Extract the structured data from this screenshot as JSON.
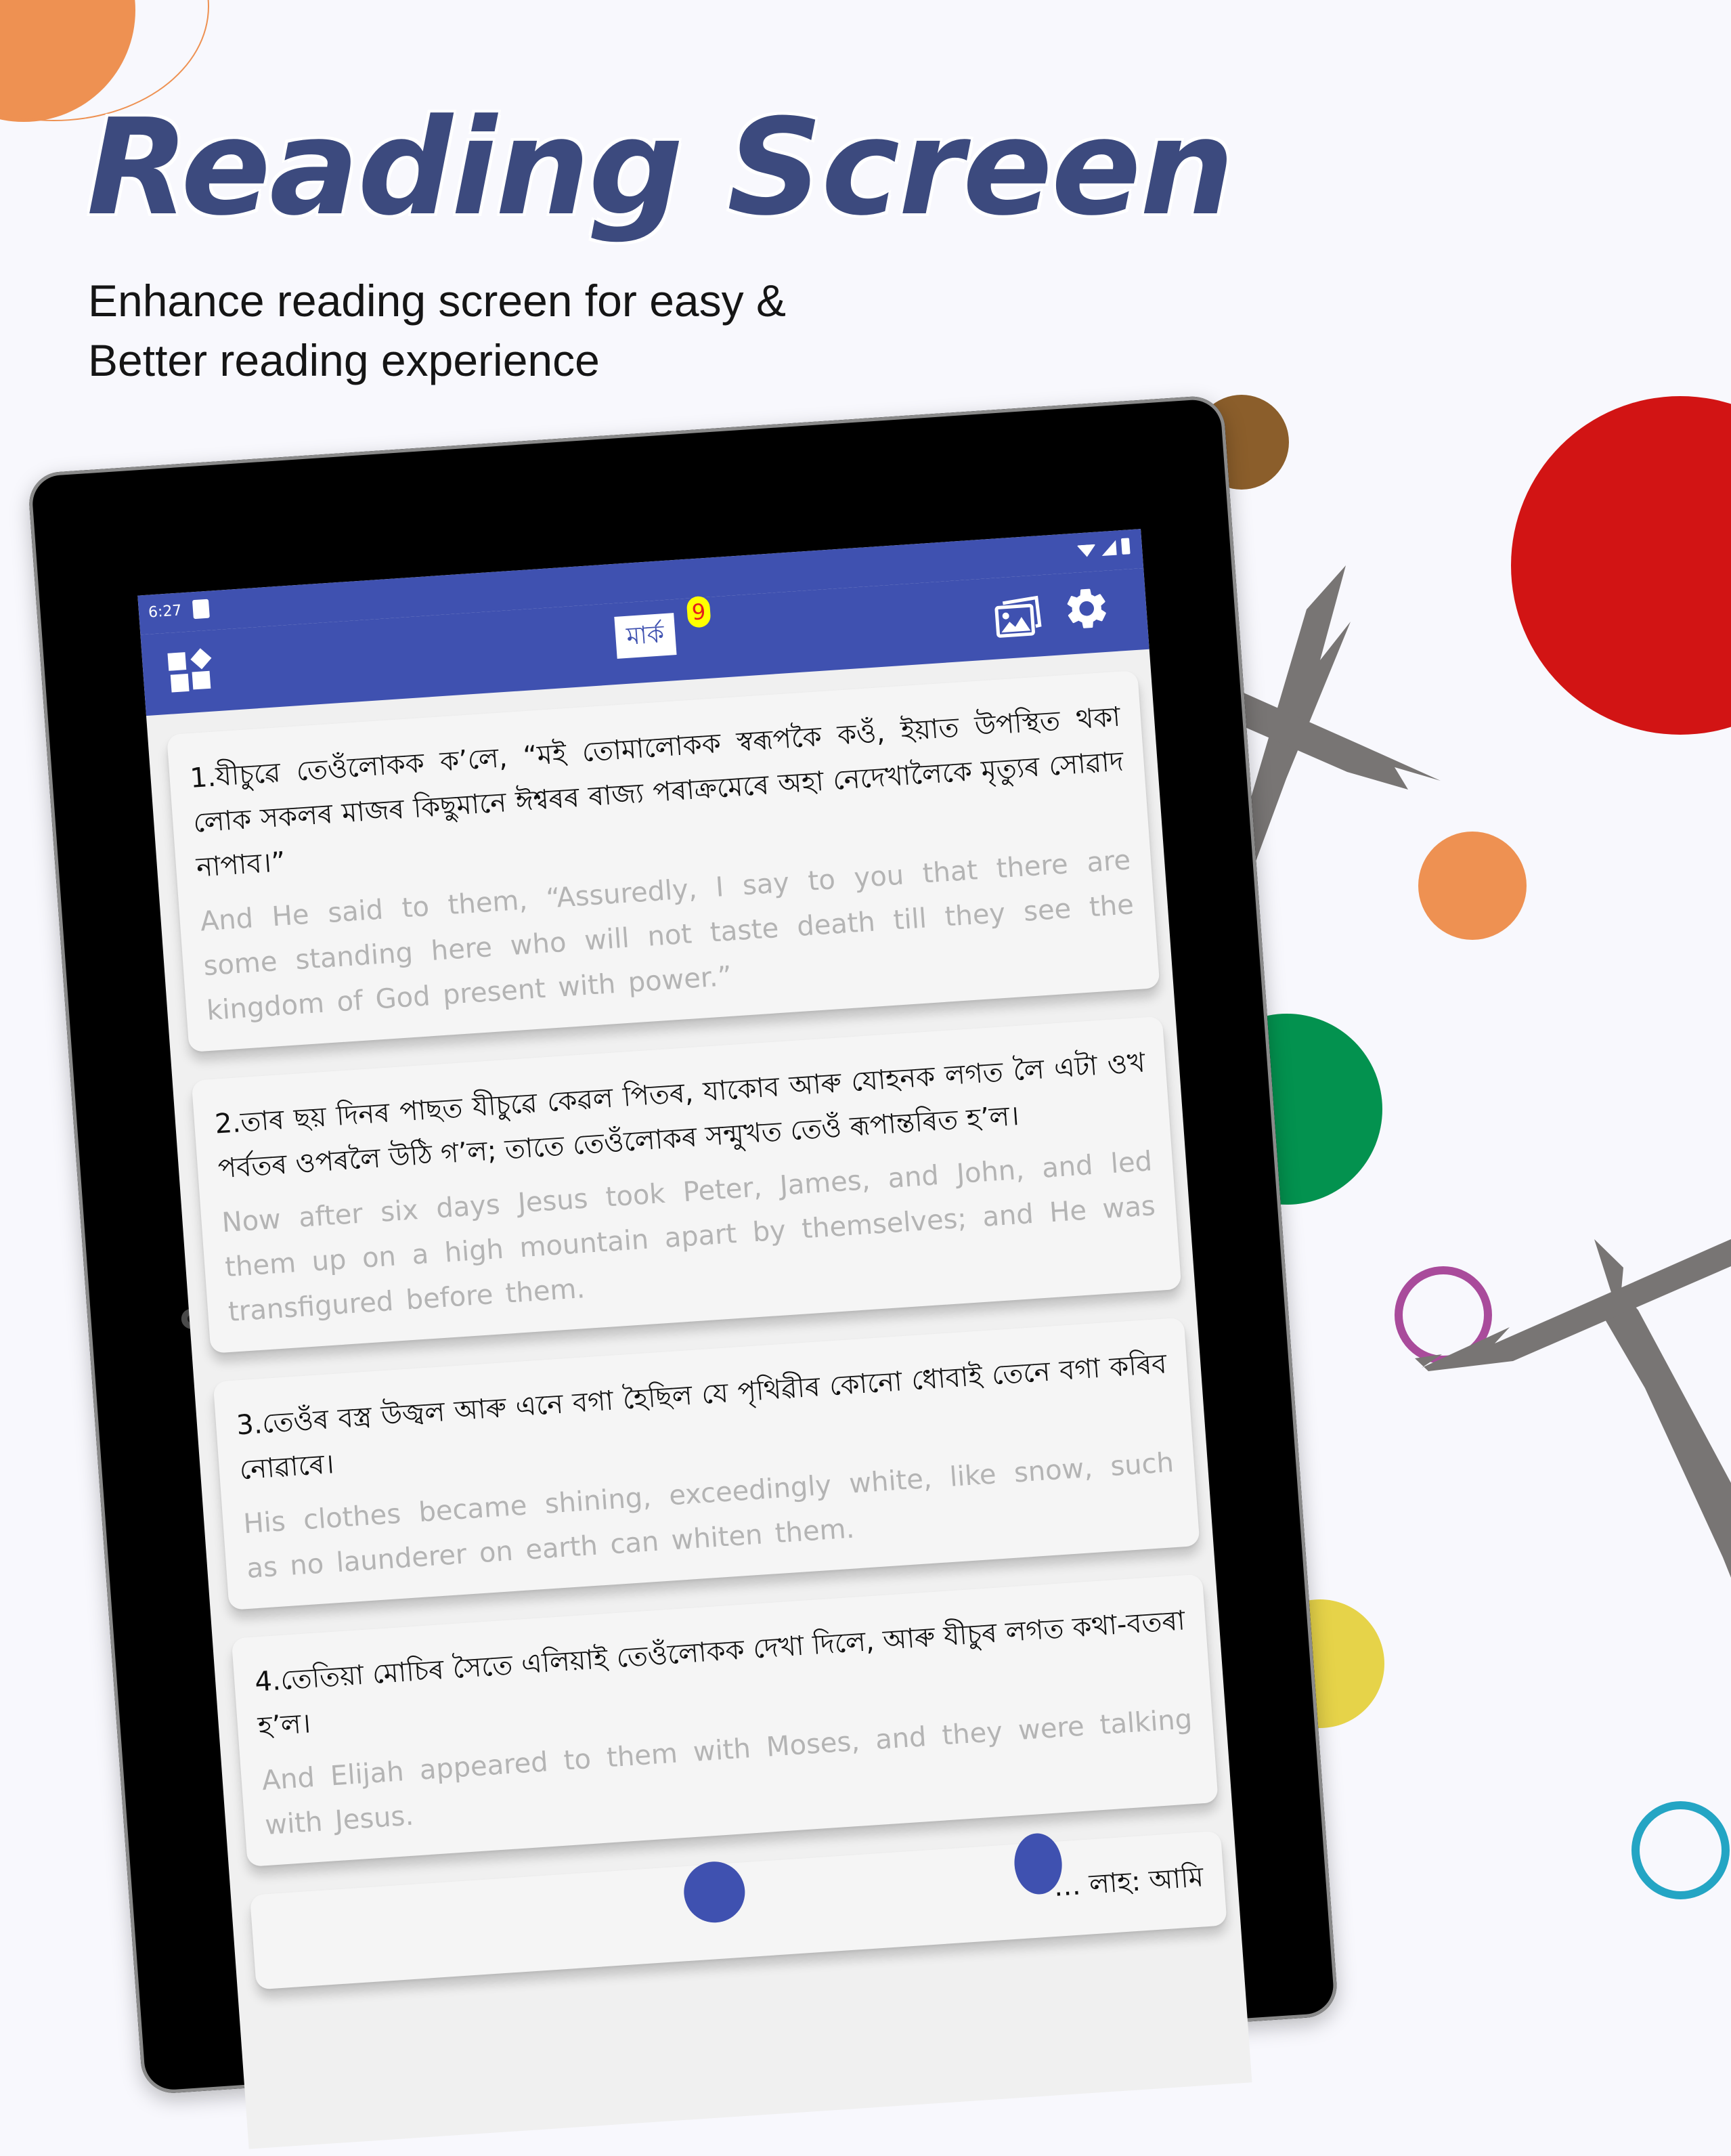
{
  "promo": {
    "title": "Reading Screen",
    "subtitle_lines": [
      "Enhance reading screen for easy &",
      "Better reading experience"
    ]
  },
  "colors": {
    "app_primary": "#3f51b0",
    "title": "#3c4a7e",
    "badge_bg": "#ffff00",
    "badge_text": "#e41c1c"
  },
  "status_bar": {
    "time": "6:27",
    "icons": [
      "notification-icon",
      "wifi-icon",
      "signal-icon",
      "battery-icon"
    ]
  },
  "app_bar": {
    "menu_icon": "dashboard-icon",
    "book_name": "মাৰ্ক",
    "chapter_badge": "9",
    "actions": [
      "gallery-icon",
      "settings-icon"
    ]
  },
  "verses": [
    {
      "number": "1.",
      "assamese": "যীচুৱে তেওঁলোকক ক’লে, “মই তোমালোকক স্বৰূপকৈ কওঁ, ইয়াত উপস্থিত থকা লোক সকলৰ মাজৰ কিছুমানে ঈশ্বৰৰ ৰাজ্য পৰাক্ৰমেৰে অহা নেদেখালৈকে মৃত্যুৰ সোৱাদ নাপাব।”",
      "english": "And He said to them, “Assuredly, I say to you that there are some standing here who will not taste death till they see the kingdom of God present with power.”"
    },
    {
      "number": "2.",
      "assamese": "তাৰ ছয় দিনৰ পাছত যীচুৱে কেৱল পিতৰ, যাকোব আৰু যোহনক লগত লৈ এটা ওখ পৰ্বতৰ ওপৰলৈ উঠি গ’ল; তাতে তেওঁলোকৰ সন্মুখত তেওঁ ৰূপান্তৰিত হ’ল।",
      "english": "Now after six days Jesus took Peter, James, and John, and led them up on a high mountain apart by themselves; and He was transfigured before them."
    },
    {
      "number": "3.",
      "assamese": "তেওঁৰ বস্ত্ৰ উজ্বল আৰু এনে বগা হৈছিল যে পৃথিৱীৰ কোনো ধোবাই তেনে বগা কৰিব নোৱাৰে।",
      "english": "His clothes became shining, exceedingly white, like snow, such as no launderer on earth can whiten them."
    },
    {
      "number": "4.",
      "assamese": "তেতিয়া মোচিৰ সৈতে এলিয়াই তেওঁলোকক দেখা দিলে, আৰু যীচুৰ লগত কথা-বতৰা হ’ল।",
      "english": "And Elijah appeared to them with Moses, and they were talking with Jesus."
    },
    {
      "number": "",
      "assamese": "… লাহ: আমি",
      "english": ""
    }
  ]
}
